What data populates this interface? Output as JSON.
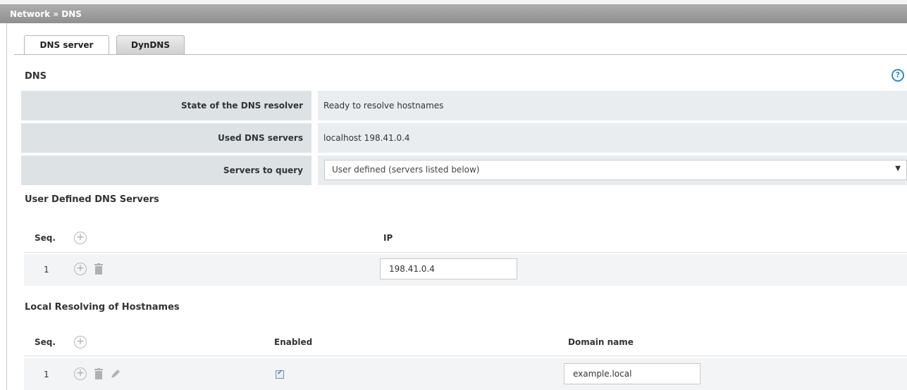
{
  "breadcrumb": "Network » DNS",
  "tabs": [
    {
      "label": "DNS server",
      "active": true
    },
    {
      "label": "DynDNS",
      "active": false
    }
  ],
  "dns_section": {
    "title": "DNS",
    "help_icon": "help-circle-icon",
    "rows": [
      {
        "label": "State of the DNS resolver",
        "value": "Ready to resolve hostnames"
      },
      {
        "label": "Used DNS servers",
        "value": "localhost 198.41.0.4"
      },
      {
        "label": "Servers to query",
        "value": "User defined (servers listed below)"
      }
    ]
  },
  "user_dns": {
    "title": "User Defined DNS Servers",
    "headers": {
      "seq": "Seq.",
      "ip": "IP"
    },
    "rows": [
      {
        "seq": "1",
        "ip": "198.41.0.4"
      }
    ]
  },
  "local_resolving": {
    "title": "Local Resolving of Hostnames",
    "headers": {
      "seq": "Seq.",
      "enabled": "Enabled",
      "domain": "Domain name"
    },
    "rows": [
      {
        "seq": "1",
        "enabled": true,
        "domain": "example.local"
      }
    ]
  },
  "colors": {
    "accent": "#2e8bc9",
    "topbar": "#9a9a9a",
    "label_bg": "#dde2e5",
    "value_bg": "#e9edef"
  }
}
